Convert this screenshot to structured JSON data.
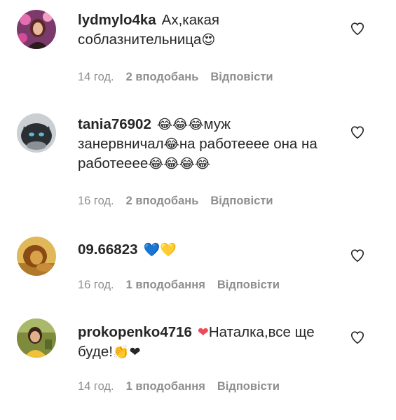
{
  "comments": [
    {
      "username": "lydmylo4ka",
      "text_before": "Ах,какая соблазнительница",
      "emojis_inline": "😍",
      "text_after": "",
      "time": "14 год.",
      "likes": "2 вподобань",
      "reply": "Відповісти",
      "avatar_icon": "avatar-woman-pink-flowers"
    },
    {
      "username": "tania76902",
      "text_before": "",
      "emoji_a": "😂😂😂",
      "text_mid1": "муж занервничал",
      "emoji_b": "😂",
      "text_mid2": "на работееее она на работееее",
      "emoji_c": "😂😂😂😂",
      "time": "16 год.",
      "likes": "2 вподобань",
      "reply": "Відповісти",
      "avatar_icon": "avatar-dark-cat"
    },
    {
      "username": "09.66823",
      "emojis_inline": "💙💛",
      "time": "16 год.",
      "likes": "1 вподобання",
      "reply": "Відповісти",
      "avatar_icon": "avatar-lion"
    },
    {
      "username": "prokopenko4716",
      "emoji_a": "❤",
      "text_mid1": "Наталка,все ще буде!",
      "emoji_b": "👏❤",
      "time": "14 год.",
      "likes": "1 вподобання",
      "reply": "Відповісти",
      "avatar_icon": "avatar-woman-outdoor"
    }
  ],
  "colors": {
    "text": "#262626",
    "meta": "#8e8e8e",
    "heart_outline": "#262626",
    "red_heart": "#ed4956",
    "blue_heart": "#1e6fd9",
    "yellow_heart": "#f7d21e"
  },
  "icons": {
    "like": "heart-outline-icon"
  }
}
